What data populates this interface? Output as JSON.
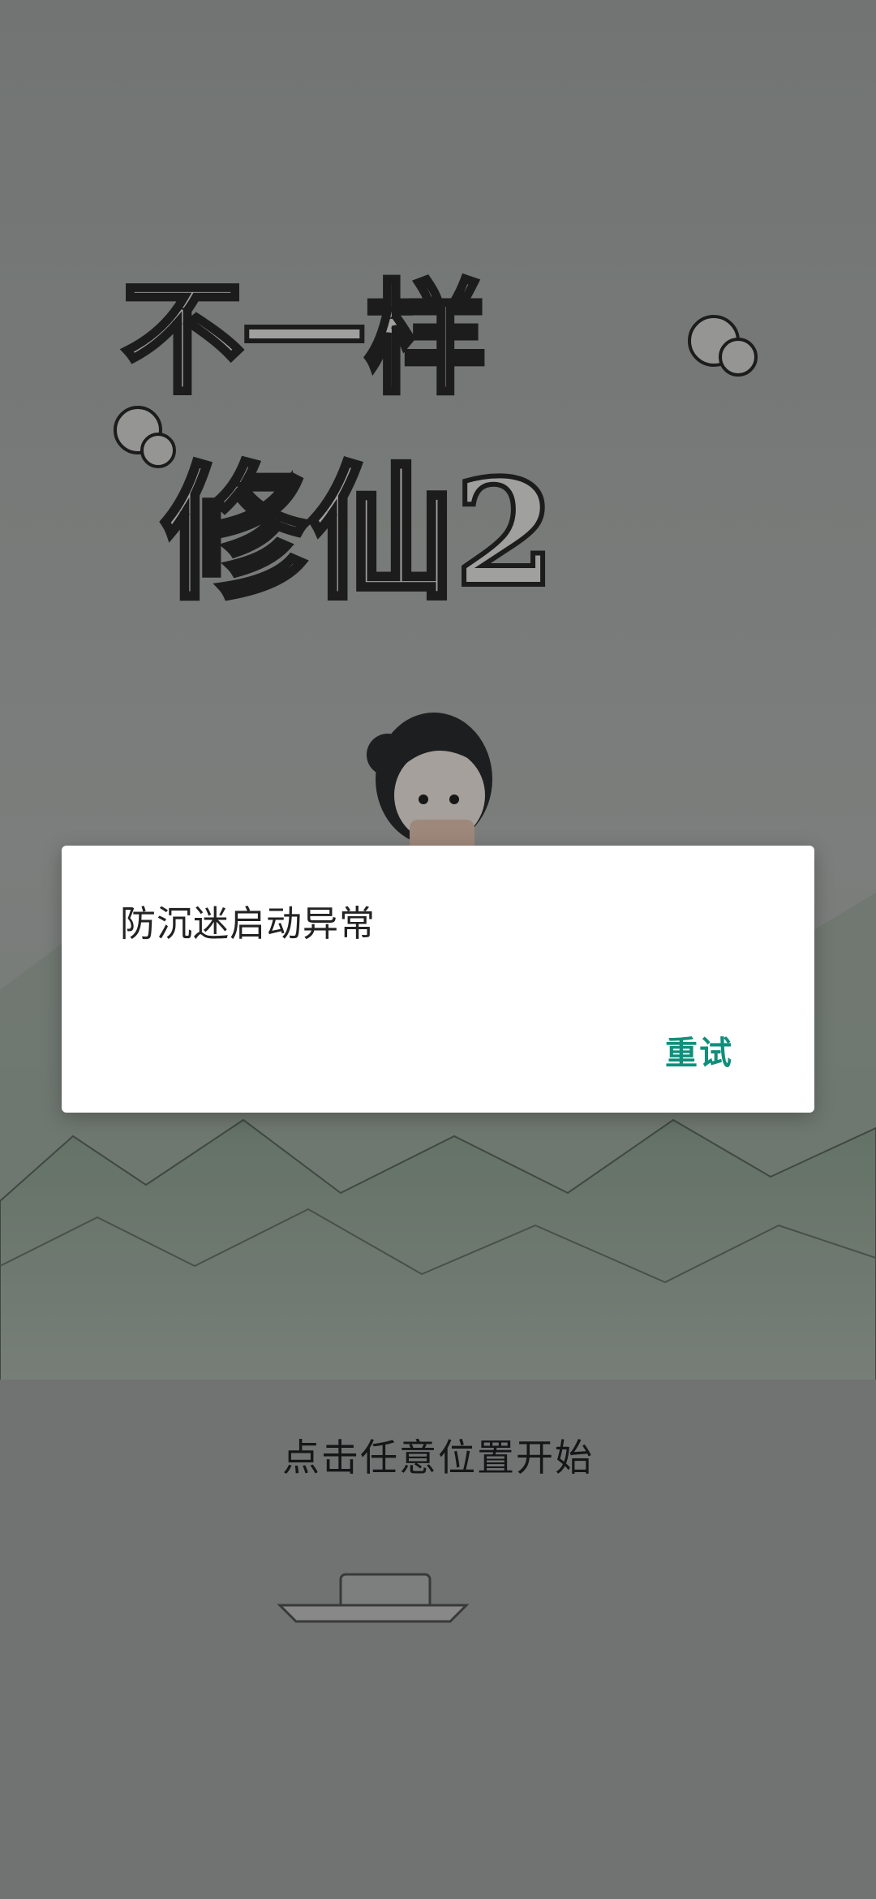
{
  "logo": {
    "line1": "不一样",
    "line2": "修仙2"
  },
  "start_hint": "点击任意位置开始",
  "dialog": {
    "message": "防沉迷启动异常",
    "retry_label": "重试"
  },
  "colors": {
    "accent": "#0f8f7c",
    "background": "#8d9291",
    "dialog_bg": "#ffffff"
  }
}
